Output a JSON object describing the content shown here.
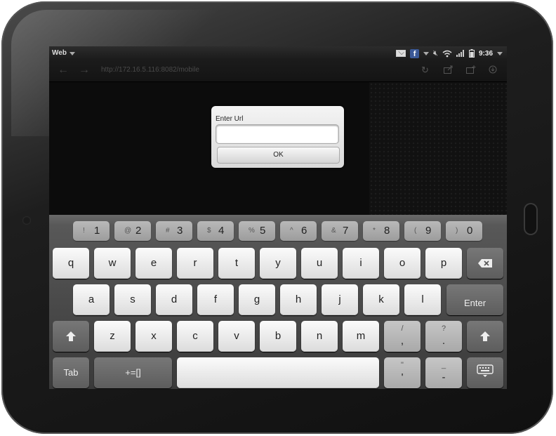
{
  "statusbar": {
    "app_menu_label": "Web",
    "time": "9:36",
    "facebook_glyph": "f"
  },
  "navbar": {
    "url": "http://172.16.5.116:8082/mobile"
  },
  "dialog": {
    "title": "Enter Url",
    "input_value": "",
    "ok_label": "OK"
  },
  "keyboard": {
    "number_row": [
      {
        "shifted": "!",
        "main": "1"
      },
      {
        "shifted": "@",
        "main": "2"
      },
      {
        "shifted": "#",
        "main": "3"
      },
      {
        "shifted": "$",
        "main": "4"
      },
      {
        "shifted": "%",
        "main": "5"
      },
      {
        "shifted": "^",
        "main": "6"
      },
      {
        "shifted": "&",
        "main": "7"
      },
      {
        "shifted": "*",
        "main": "8"
      },
      {
        "shifted": "(",
        "main": "9"
      },
      {
        "shifted": ")",
        "main": "0"
      }
    ],
    "row1": [
      "q",
      "w",
      "e",
      "r",
      "t",
      "y",
      "u",
      "i",
      "o",
      "p"
    ],
    "row2": [
      "a",
      "s",
      "d",
      "f",
      "g",
      "h",
      "j",
      "k",
      "l"
    ],
    "row3": [
      "z",
      "x",
      "c",
      "v",
      "b",
      "n",
      "m"
    ],
    "slash_key": {
      "upper": "/",
      "lower": ","
    },
    "question_key": {
      "upper": "?",
      "lower": "."
    },
    "quote_key": {
      "upper": "\"",
      "lower": "'"
    },
    "dash_key": {
      "upper": "_",
      "lower": "-"
    },
    "enter_label": "Enter",
    "tab_label": "Tab",
    "symbols_label": "+=[]",
    "space_label": ""
  }
}
